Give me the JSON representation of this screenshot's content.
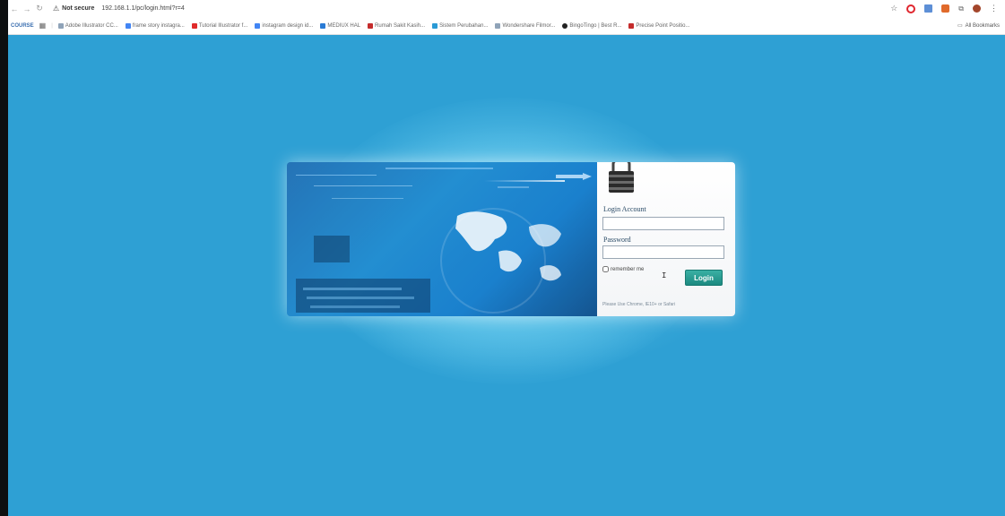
{
  "browser": {
    "security_label": "Not secure",
    "url": "192.168.1.1/pc/login.html?r=4",
    "bookmarks": [
      {
        "label": "Adobe Illustrator CC...",
        "color": "#8fa3b8"
      },
      {
        "label": "frame story instagra...",
        "color": "#4285f4"
      },
      {
        "label": "Tutorial Illustrator f...",
        "color": "#e02b2b"
      },
      {
        "label": "instagram design id...",
        "color": "#4285f4"
      },
      {
        "label": "MEDIUX HAL",
        "color": "#2a7bd5"
      },
      {
        "label": "Rumah Sakit Kasih...",
        "color": "#c42c2c"
      },
      {
        "label": "Sistem Perubahan...",
        "color": "#2a9ad5"
      },
      {
        "label": "Wondershare Filmor...",
        "color": "#8fa3b8"
      },
      {
        "label": "BingoTingo | Best R...",
        "color": "#222222"
      },
      {
        "label": "Precise Point Positio...",
        "color": "#c42c2c"
      }
    ],
    "course_label": "COURSE",
    "all_bookmarks": "All Bookmarks"
  },
  "login": {
    "account_label": "Login Account",
    "password_label": "Password",
    "remember_label": "remember me",
    "button_label": "Login",
    "hint": "Please Use Chrome, IE10+ or Safari"
  },
  "colors": {
    "page_bg": "#2ea0d4",
    "button": "#1c8a80"
  }
}
